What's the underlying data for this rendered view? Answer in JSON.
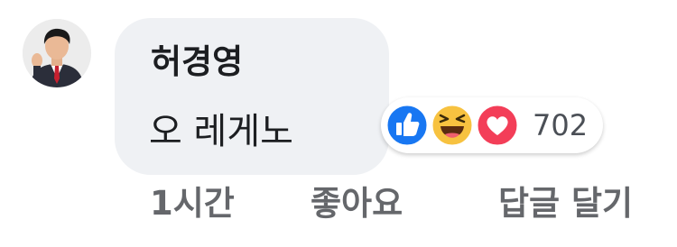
{
  "comment": {
    "author": "허경영",
    "text": "오 레게노",
    "avatar_icon": "profile-photo",
    "bubble_color": "#eff1f4"
  },
  "reactions": {
    "icons": [
      "like-icon",
      "haha-icon",
      "love-icon"
    ],
    "count": "702",
    "colors": {
      "like": "#1877f2",
      "haha": "#f7c240",
      "love": "#f33e58"
    }
  },
  "actions": {
    "time": "1시간",
    "like": "좋아요",
    "reply": "답글 달기"
  }
}
